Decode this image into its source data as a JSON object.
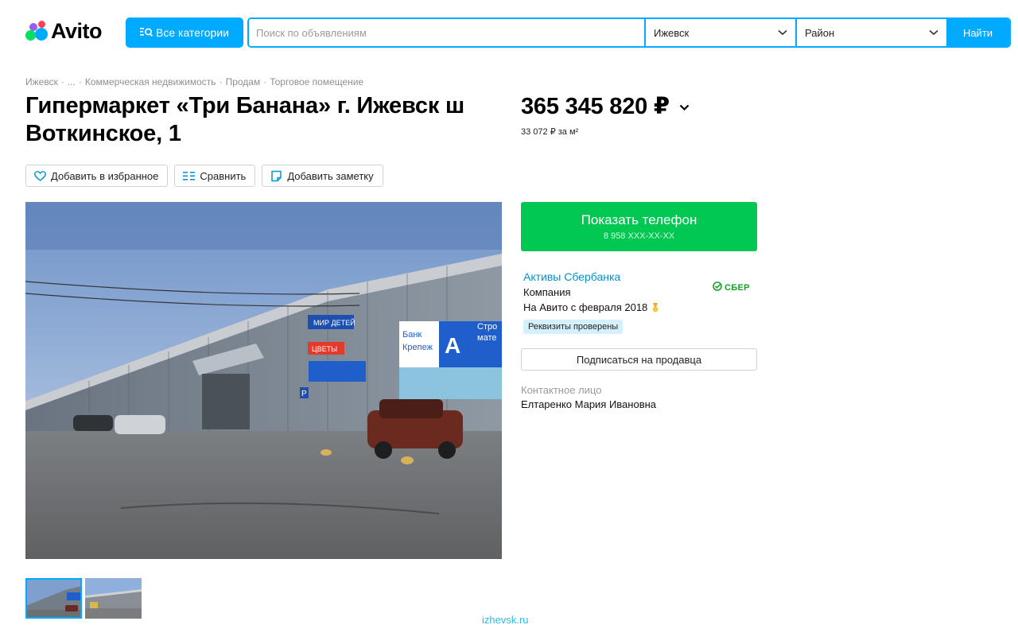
{
  "header": {
    "logo_text": "Avito",
    "categories_label": "Все категории",
    "search_placeholder": "Поиск по объявлениям",
    "city": "Ижевск",
    "district": "Район",
    "find_label": "Найти",
    "accent_color": "#00aaff"
  },
  "breadcrumb": [
    "Ижевск",
    "...",
    "Коммерческая недвижимость",
    "Продам",
    "Торговое помещение"
  ],
  "listing": {
    "title": "Гипермаркет «Три Банана» г. Ижевск ш Воткинское, 1",
    "price": "365 345 820 ₽",
    "price_per_m2": "33 072 ₽ за м²",
    "actions": {
      "favorite": "Добавить в избранное",
      "compare": "Сравнить",
      "note": "Добавить заметку"
    },
    "photo": {
      "signs": {
        "bank": "Банк",
        "krepezh": "Крепеж",
        "letter": "А",
        "stroi": "Стро",
        "mat": "мате",
        "mir": "МИР ДЕТЕЙ",
        "cvety": "ЦВЕТЫ",
        "parking": "P"
      }
    },
    "thumbnail_count": 2
  },
  "seller": {
    "phone_label": "Показать телефон",
    "phone_number": "8 958 XXX-XX-XX",
    "phone_button_color": "#00c853",
    "name": "Активы Сбербанка",
    "type": "Компания",
    "since": "На Авито с февраля 2018",
    "verified": "Реквизиты проверены",
    "brand": "СБЕР",
    "subscribe": "Подписаться на продавца",
    "contact_label": "Контактное лицо",
    "contact_name": "Елтаренко Мария Ивановна"
  },
  "watermark": "izhevsk.ru"
}
